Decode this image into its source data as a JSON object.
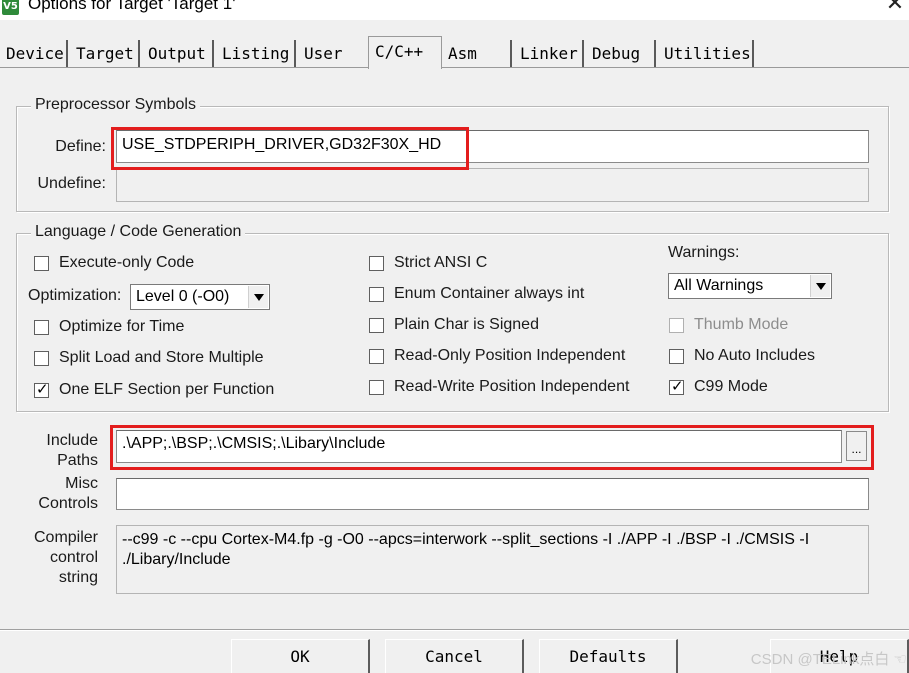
{
  "window": {
    "title": "Options for Target 'Target 1'",
    "app_icon": "uvision-icon",
    "close_glyph": "✕"
  },
  "tabs": [
    {
      "label": "Device",
      "active": false
    },
    {
      "label": "Target",
      "active": false
    },
    {
      "label": "Output",
      "active": false
    },
    {
      "label": "Listing",
      "active": false
    },
    {
      "label": "User",
      "active": false
    },
    {
      "label": "C/C++",
      "active": true
    },
    {
      "label": "Asm",
      "active": false
    },
    {
      "label": "Linker",
      "active": false
    },
    {
      "label": "Debug",
      "active": false
    },
    {
      "label": "Utilities",
      "active": false
    }
  ],
  "preprocessor": {
    "legend": "Preprocessor Symbols",
    "define_label": "Define:",
    "define_value": "USE_STDPERIPH_DRIVER,GD32F30X_HD",
    "undefine_label": "Undefine:",
    "undefine_value": ""
  },
  "language": {
    "legend": "Language / Code Generation",
    "execute_only": {
      "label": "Execute-only Code",
      "checked": false
    },
    "optimization_label": "Optimization:",
    "optimization_value": "Level 0 (-O0)",
    "optimize_for_time": {
      "label": "Optimize for Time",
      "checked": false
    },
    "split_load_store": {
      "label": "Split Load and Store Multiple",
      "checked": false
    },
    "one_elf_section": {
      "label": "One ELF Section per Function",
      "checked": true
    },
    "strict_ansi": {
      "label": "Strict ANSI C",
      "checked": false
    },
    "enum_container": {
      "label": "Enum Container always int",
      "checked": false
    },
    "plain_char_signed": {
      "label": "Plain Char is Signed",
      "checked": false
    },
    "ro_position_independent": {
      "label": "Read-Only Position Independent",
      "checked": false
    },
    "rw_position_independent": {
      "label": "Read-Write Position Independent",
      "checked": false
    },
    "warnings_label": "Warnings:",
    "warnings_value": "All Warnings",
    "thumb_mode": {
      "label": "Thumb Mode",
      "checked": false,
      "disabled": true
    },
    "no_auto_includes": {
      "label": "No Auto Includes",
      "checked": false
    },
    "c99_mode": {
      "label": "C99 Mode",
      "checked": true
    }
  },
  "paths": {
    "include_label_1": "Include",
    "include_label_2": "Paths",
    "include_value": ".\\APP;.\\BSP;.\\CMSIS;.\\Libary\\Include",
    "browse_label": "...",
    "misc_label_1": "Misc",
    "misc_label_2": "Controls",
    "misc_value": "",
    "compiler_label_1": "Compiler",
    "compiler_label_2": "control",
    "compiler_label_3": "string",
    "compiler_value": "--c99 -c --cpu Cortex-M4.fp -g -O0 --apcs=interwork --split_sections -I ./APP -I ./BSP -I ./CMSIS -I ./Libary/Include"
  },
  "buttons": {
    "ok": "OK",
    "cancel": "Cancel",
    "defaults": "Defaults",
    "help": "Help"
  },
  "watermark": "CSDN @TELink点白 ☜",
  "colors": {
    "highlight": "#e31d1d",
    "dialog_bg": "#f0f0f0"
  }
}
